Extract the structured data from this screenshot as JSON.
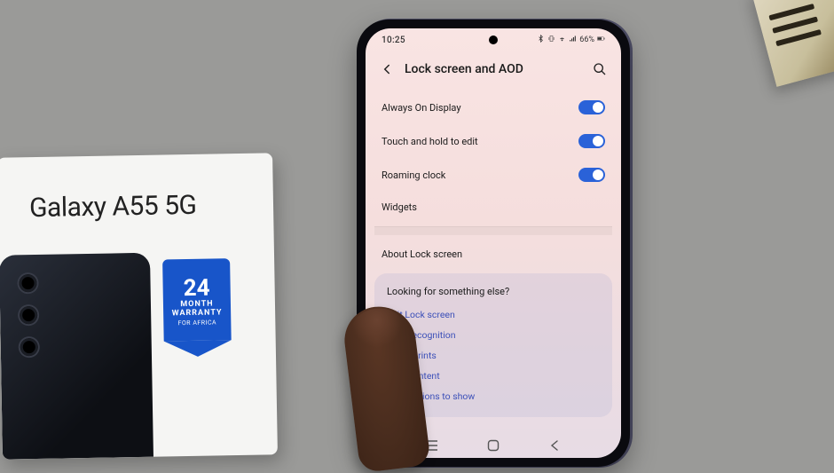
{
  "box": {
    "title": "Galaxy A55 5G",
    "warranty": {
      "number": "24",
      "unit": "MONTH",
      "label": "WARRANTY",
      "region": "FOR AFRICA"
    }
  },
  "status": {
    "time": "10:25",
    "battery": "66%"
  },
  "header": {
    "title": "Lock screen and AOD"
  },
  "settings": {
    "aod": {
      "label": "Always On Display",
      "on": true
    },
    "touch_edit": {
      "label": "Touch and hold to edit",
      "on": true
    },
    "roaming": {
      "label": "Roaming clock",
      "on": true
    },
    "widgets": {
      "label": "Widgets"
    },
    "about": {
      "label": "About Lock screen"
    }
  },
  "suggestions": {
    "title": "Looking for something else?",
    "links": {
      "edit_lock": "Edit Lock screen",
      "face": "Face recognition",
      "fingerprints": "Fingerprints",
      "hide": "Hide content",
      "notifications": "Notifications to show"
    }
  }
}
